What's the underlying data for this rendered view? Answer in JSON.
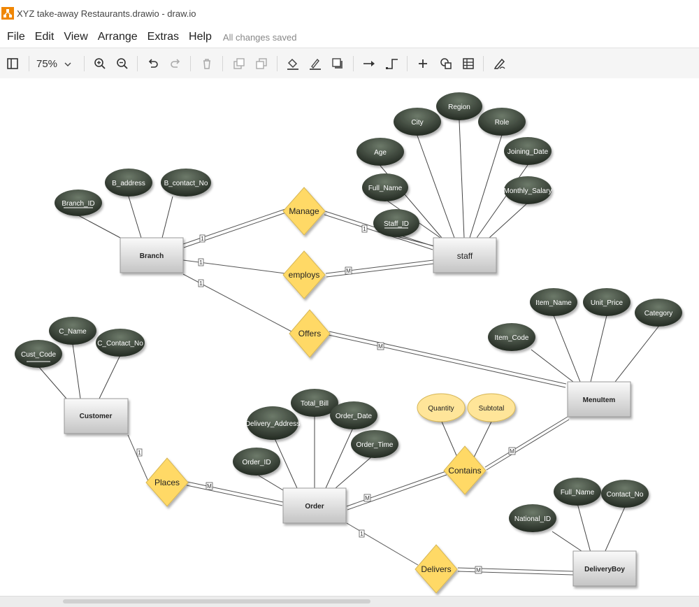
{
  "window": {
    "title": "XYZ take-away Restaurants.drawio - draw.io"
  },
  "menubar": {
    "items": [
      "File",
      "Edit",
      "View",
      "Arrange",
      "Extras",
      "Help"
    ],
    "status": "All changes saved"
  },
  "toolbar": {
    "zoom": "75%",
    "icons": [
      "sidebar-toggle-icon",
      "zoom-in-icon",
      "zoom-out-icon",
      "undo-icon",
      "redo-icon",
      "delete-icon",
      "to-front-icon",
      "to-back-icon",
      "fill-color-icon",
      "line-color-icon",
      "shadow-icon",
      "connection-icon",
      "waypoints-icon",
      "insert-icon",
      "shapes-icon",
      "table-icon",
      "freehand-icon"
    ]
  },
  "colors": {
    "ellipse_dark": "#2c3329",
    "ellipse_light": "#6d7a6a",
    "rel_fill": "#ffd966",
    "attr_yellow": "#ffe599",
    "entity_top": "#fafafa",
    "entity_bottom": "#c8c8c8"
  },
  "diagram": {
    "entities": {
      "branch": "Branch",
      "staff": "staff",
      "customer": "Customer",
      "menuitem": "MenuItem",
      "order": "Order",
      "deliveryboy": "DeliveryBoy"
    },
    "relationships": {
      "manage": "Manage",
      "employs": "employs",
      "offers": "Offers",
      "places": "Places",
      "contains": "Contains",
      "delivers": "Delivers"
    },
    "attributes": {
      "branch_id": "Branch_ID",
      "b_address": "B_address",
      "b_contact_no": "B_contact_No",
      "city": "City",
      "region": "Region",
      "role": "Role",
      "age": "Age",
      "joining_date": "Joining_Date",
      "staff_full_name": "Full_Name",
      "monthly_salary": "Monthly_Salary",
      "staff_id": "Staff_ID",
      "item_name": "Item_Name",
      "unit_price": "Unit_Price",
      "category": "Category",
      "item_code": "Item_Code",
      "c_name": "C_Name",
      "c_contact_no": "C_Contact_No",
      "cust_code": "Cust_Code",
      "total_bill": "Total_Bill",
      "delivery_address": "Delivery_Address",
      "order_date": "Order_Date",
      "order_time": "Order_Time",
      "order_id": "Order_ID",
      "quantity": "Quantity",
      "subtotal": "Subtotal",
      "db_full_name": "Full_Name",
      "contact_no": "Contact_No",
      "national_id": "National_ID"
    },
    "cardinality": {
      "one": "1",
      "many": "M"
    }
  }
}
